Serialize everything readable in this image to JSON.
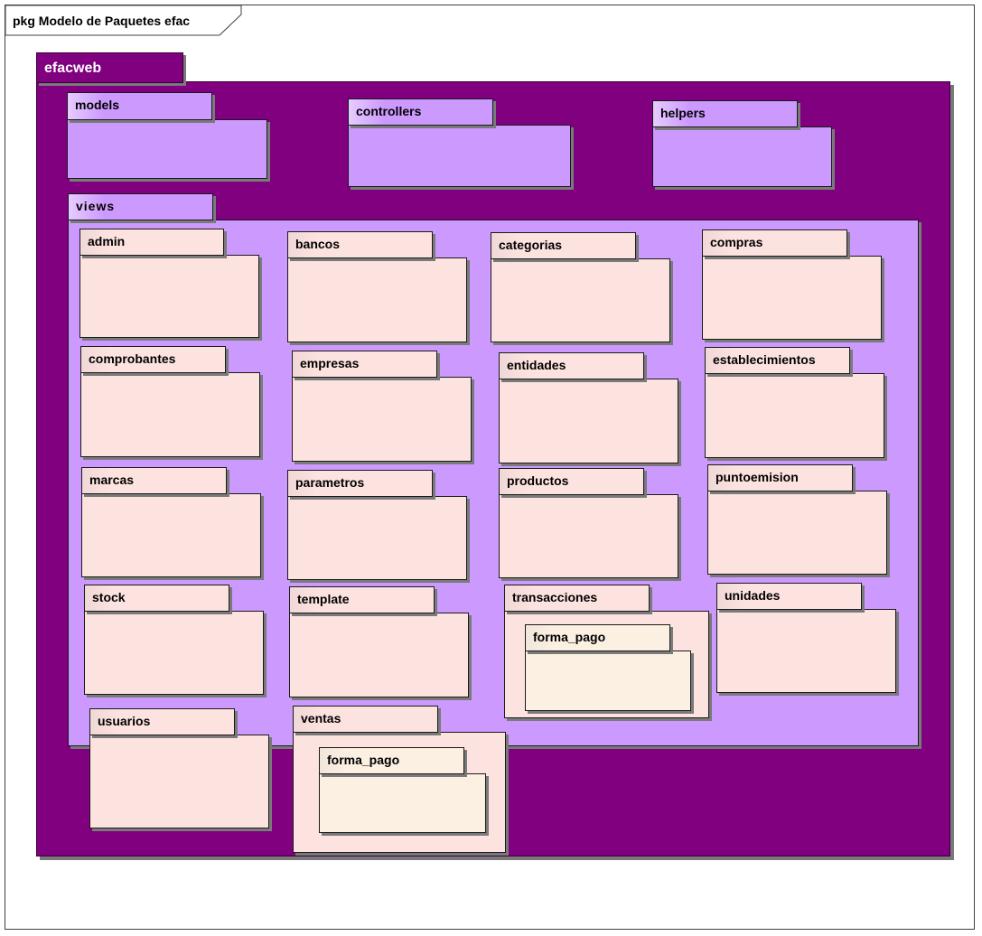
{
  "diagram": {
    "frame_title": "pkg Modelo de Paquetes efac",
    "root_package": "efacweb",
    "top_packages": {
      "models": "models",
      "controllers": "controllers",
      "helpers": "helpers",
      "views": "views"
    },
    "views_packages": {
      "admin": "admin",
      "bancos": "bancos",
      "categorias": "categorias",
      "compras": "compras",
      "comprobantes": "comprobantes",
      "empresas": "empresas",
      "entidades": "entidades",
      "establecimientos": "establecimientos",
      "marcas": "marcas",
      "parametros": "parametros",
      "productos": "productos",
      "puntoemision": "puntoemision",
      "stock": "stock",
      "template": "template",
      "transacciones": "transacciones",
      "unidades": "unidades",
      "usuarios": "usuarios",
      "ventas": "ventas"
    },
    "nested_packages": {
      "transacciones_forma_pago": "forma_pago",
      "ventas_forma_pago": "forma_pago"
    },
    "colors": {
      "root": "#800080",
      "level1": "#cc99ff",
      "level2": "#fde3e0",
      "level3": "#fbf0e2"
    }
  }
}
